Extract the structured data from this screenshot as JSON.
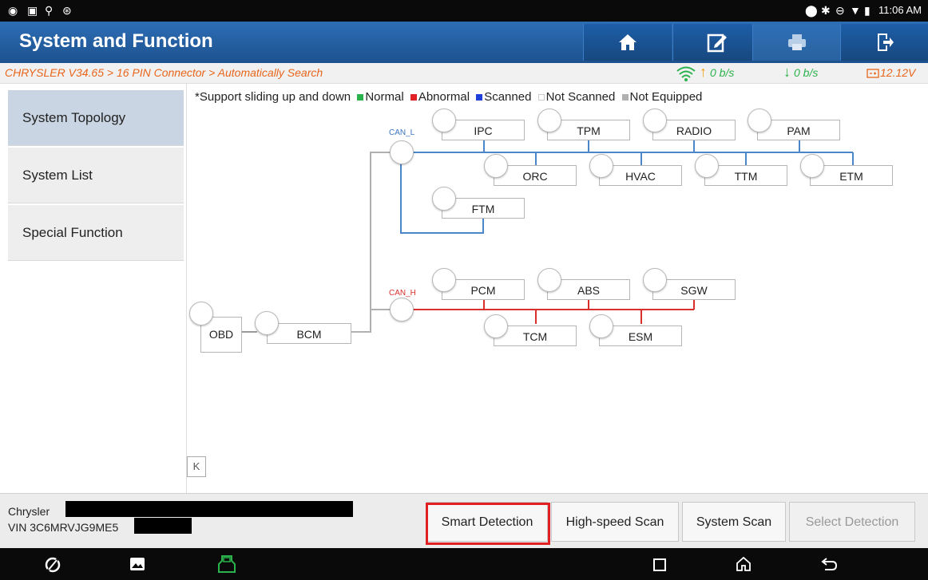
{
  "status_bar": {
    "time": "11:06 AM",
    "left_icons": [
      "app-icon",
      "image-icon",
      "usb-icon",
      "settings-icon"
    ],
    "right_icons": [
      "location-icon",
      "bluetooth-icon",
      "dnd-icon",
      "wifi-icon",
      "battery-icon"
    ]
  },
  "header": {
    "title": "System and Function",
    "buttons": [
      "home-icon",
      "edit-icon",
      "print-icon",
      "exit-icon"
    ]
  },
  "breadcrumb": "CHRYSLER V34.65 > 16 PIN Connector > Automatically Search",
  "rates": {
    "upload": "0 b/s",
    "download": "0 b/s",
    "voltage": "12.12V"
  },
  "sidebar": {
    "items": [
      {
        "label": "System Topology",
        "active": true
      },
      {
        "label": "System List",
        "active": false
      },
      {
        "label": "Special Function",
        "active": false
      }
    ]
  },
  "legend": {
    "prefix": "*Support sliding up and down",
    "items": [
      {
        "label": "Normal",
        "color": "#2bb24c"
      },
      {
        "label": "Abnormal",
        "color": "#e02024"
      },
      {
        "label": "Scanned",
        "color": "#1f3fd9"
      },
      {
        "label": "Not Scanned",
        "color": "#ffffff"
      },
      {
        "label": "Not Equipped",
        "color": "#b0b0b0"
      }
    ]
  },
  "topology": {
    "can_l_label": "CAN_L",
    "can_h_label": "CAN_H",
    "can_l_color": "#4a86c8",
    "can_h_color": "#d9302c",
    "root_nodes": [
      "OBD",
      "BCM"
    ],
    "can_l_nodes": [
      "IPC",
      "TPM",
      "RADIO",
      "PAM",
      "ORC",
      "HVAC",
      "TTM",
      "ETM",
      "FTM"
    ],
    "can_h_nodes": [
      "PCM",
      "ABS",
      "SGW",
      "TCM",
      "ESM"
    ],
    "collapse_icon": "K"
  },
  "vehicle": {
    "make": "Chrysler",
    "vin": "VIN 3C6MRVJG9ME5"
  },
  "actions": [
    {
      "label": "Smart Detection",
      "enabled": true
    },
    {
      "label": "High-speed Scan",
      "enabled": true
    },
    {
      "label": "System Scan",
      "enabled": true
    },
    {
      "label": "Select Detection",
      "enabled": false
    }
  ],
  "nav_bar": [
    "browser-icon",
    "gallery-icon",
    "vci-icon",
    "recents-icon",
    "home-icon",
    "back-icon"
  ]
}
